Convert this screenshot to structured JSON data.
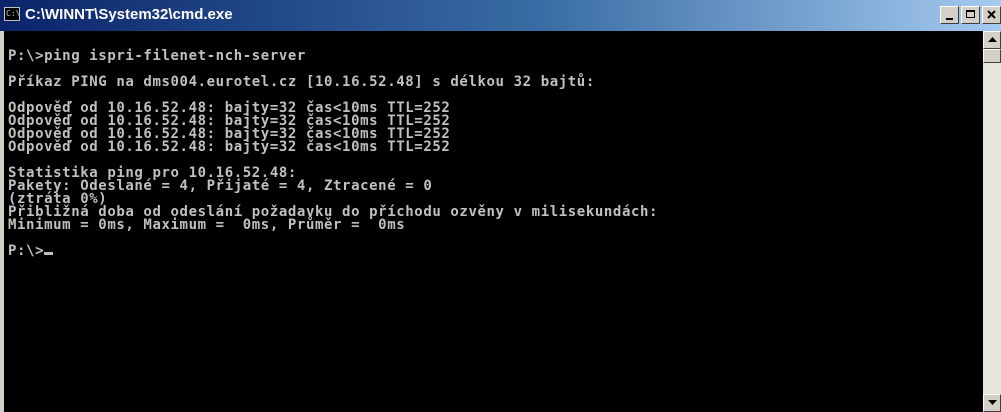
{
  "window": {
    "title": "C:\\WINNT\\System32\\cmd.exe",
    "icon": "cmd-icon",
    "buttons": {
      "minimize": "minimize-icon",
      "maximize": "maximize-icon",
      "close": "close-icon"
    }
  },
  "console": {
    "lines": [
      "",
      "P:\\>ping ispri-filenet-nch-server",
      "",
      "Příkaz PING na dms004.eurotel.cz [10.16.52.48] s délkou 32 bajtů:",
      "",
      "Odpověď od 10.16.52.48: bajty=32 čas<10ms TTL=252",
      "Odpověď od 10.16.52.48: bajty=32 čas<10ms TTL=252",
      "Odpověď od 10.16.52.48: bajty=32 čas<10ms TTL=252",
      "Odpověď od 10.16.52.48: bajty=32 čas<10ms TTL=252",
      "",
      "Statistika ping pro 10.16.52.48:",
      "Pakety: Odeslané = 4, Přijaté = 4, Ztracené = 0",
      "(ztráta 0%)",
      "Přibližná doba od odeslání požadavku do příchodu ozvěny v milisekundách:",
      "Minimum = 0ms, Maximum =  0ms, Průměr =  0ms",
      ""
    ],
    "prompt": "P:\\>"
  },
  "colors": {
    "console_bg": "#000000",
    "console_fg": "#c0c0c0",
    "titlebar_start": "#0a246a",
    "titlebar_end": "#a6caf0"
  }
}
